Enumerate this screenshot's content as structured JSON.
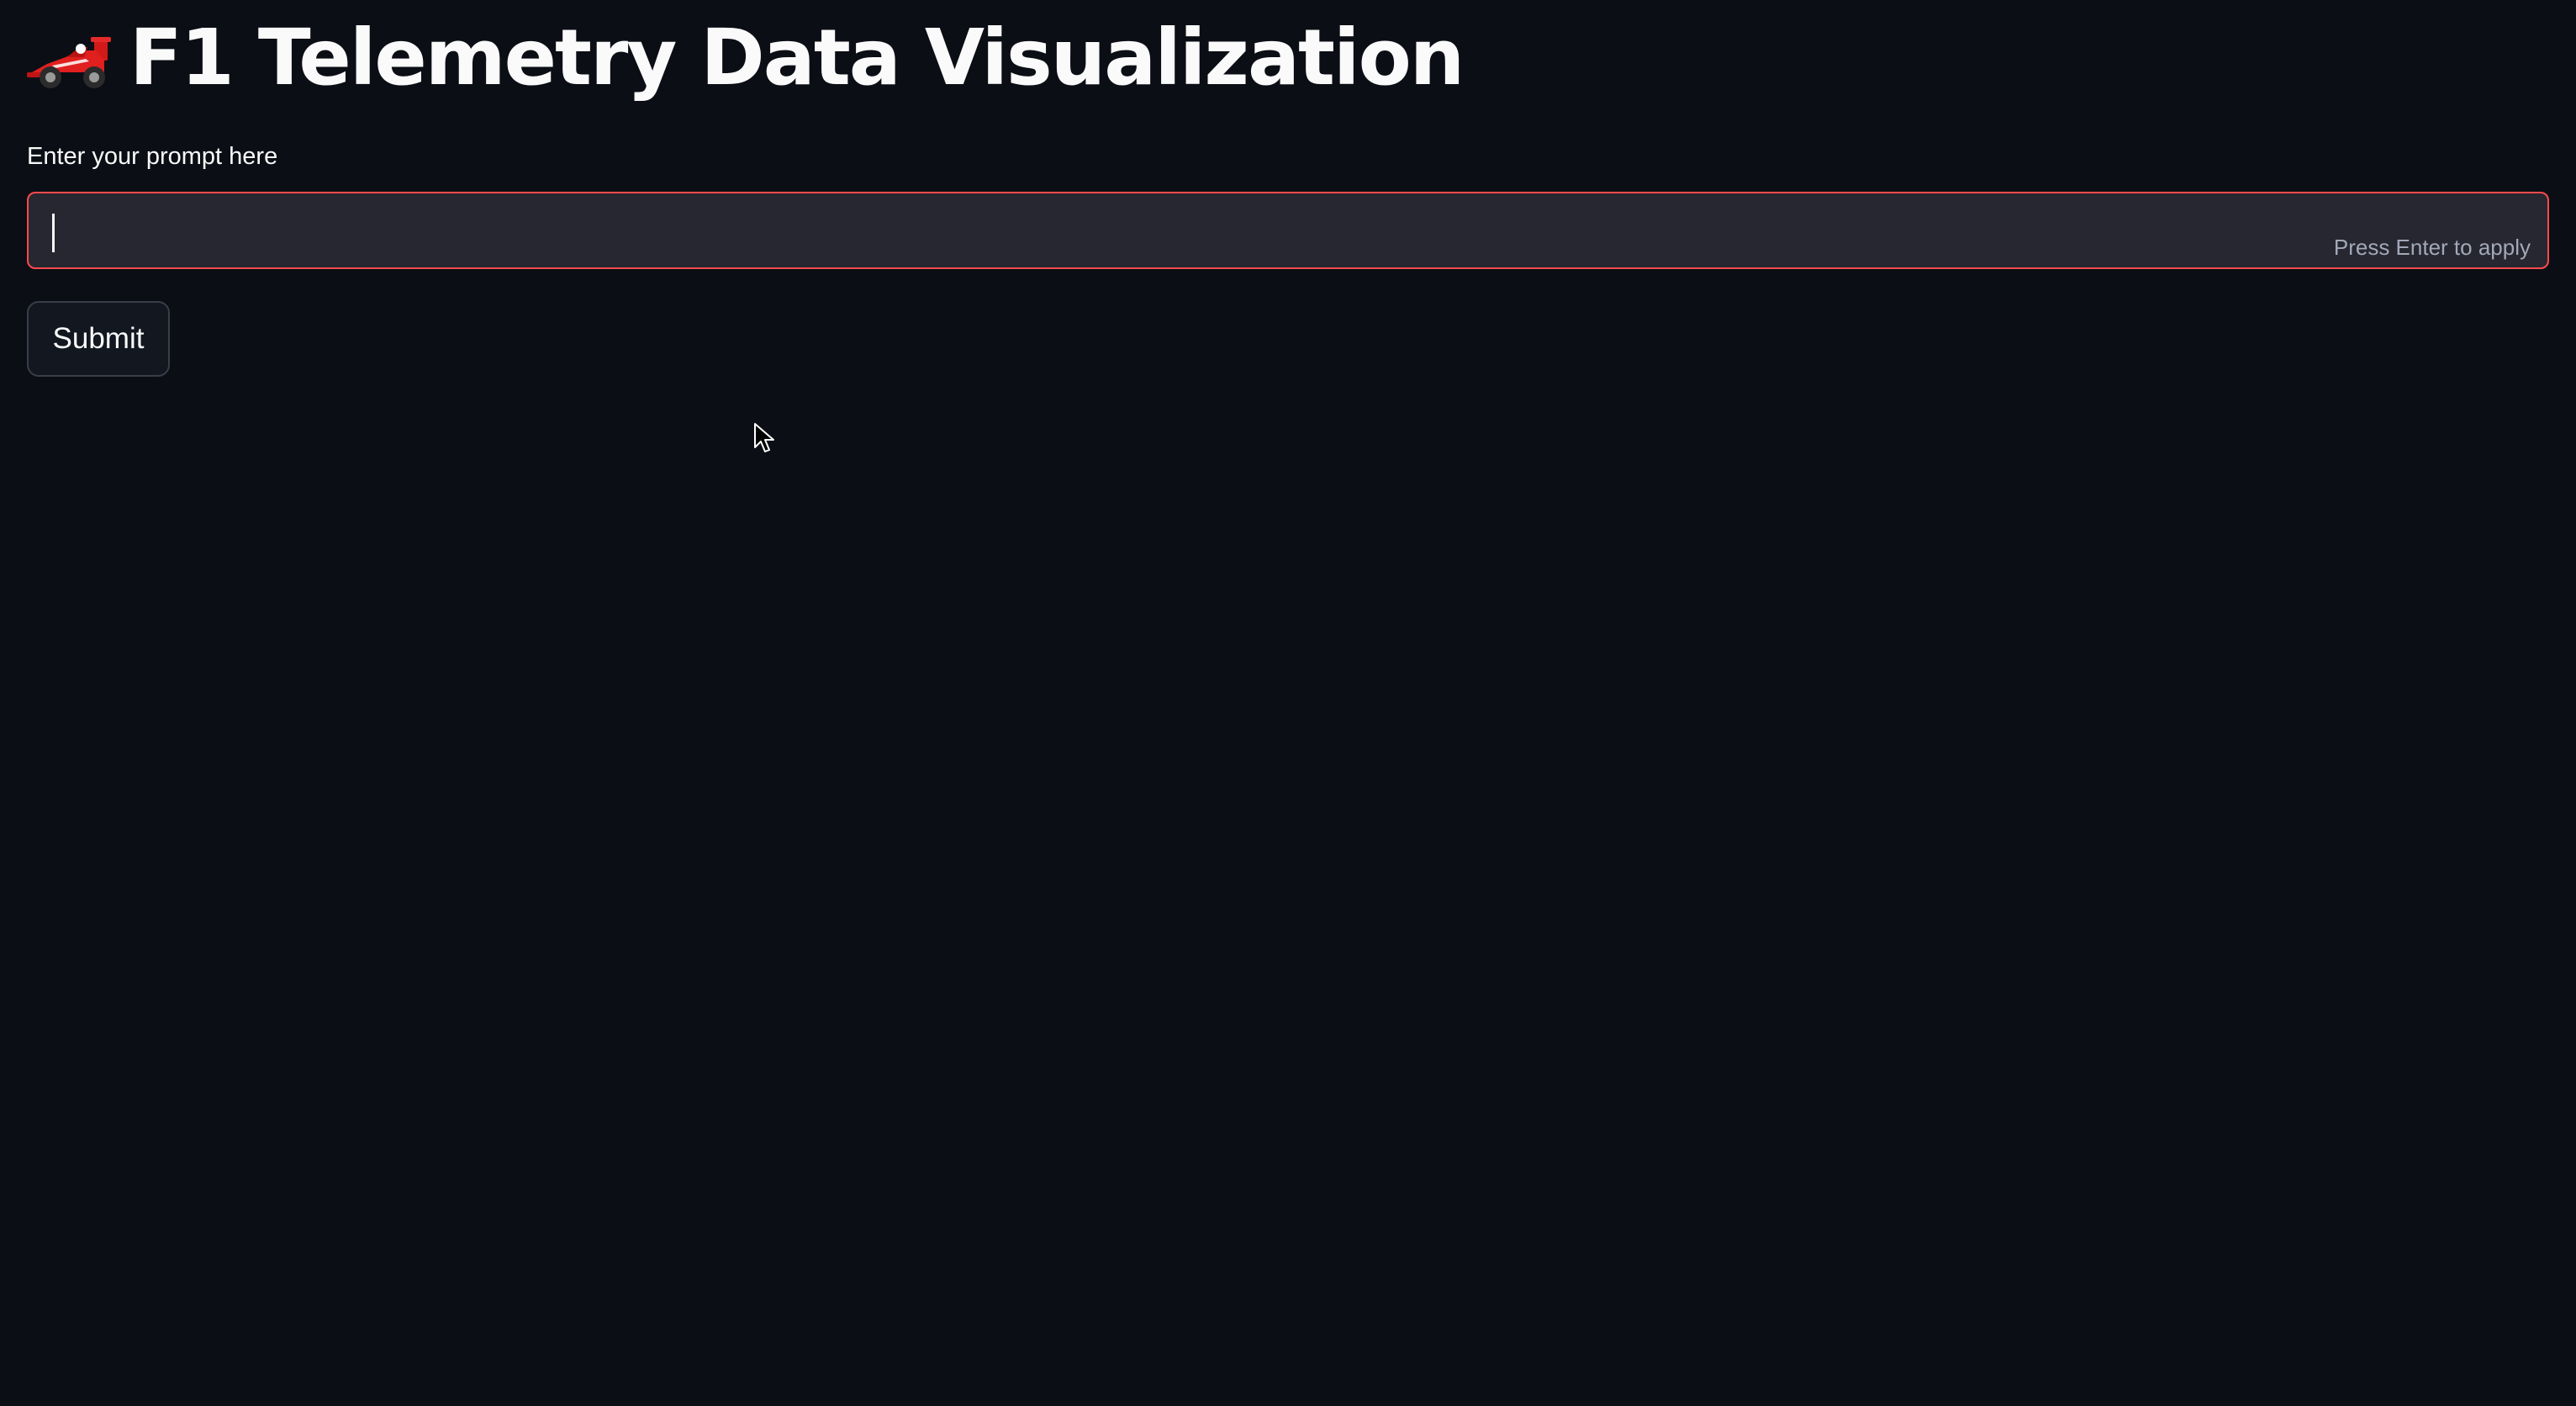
{
  "header": {
    "title": "F1 Telemetry Data Visualization",
    "icon": "racing-car-icon"
  },
  "prompt": {
    "label": "Enter your prompt here",
    "value": "",
    "hint": "Press Enter to apply"
  },
  "actions": {
    "submit_label": "Submit"
  },
  "colors": {
    "background": "#0b0e15",
    "input_background": "#262730",
    "accent": "#ff4b4b",
    "text": "#fafafa",
    "hint_text": "#a3a8b8"
  }
}
